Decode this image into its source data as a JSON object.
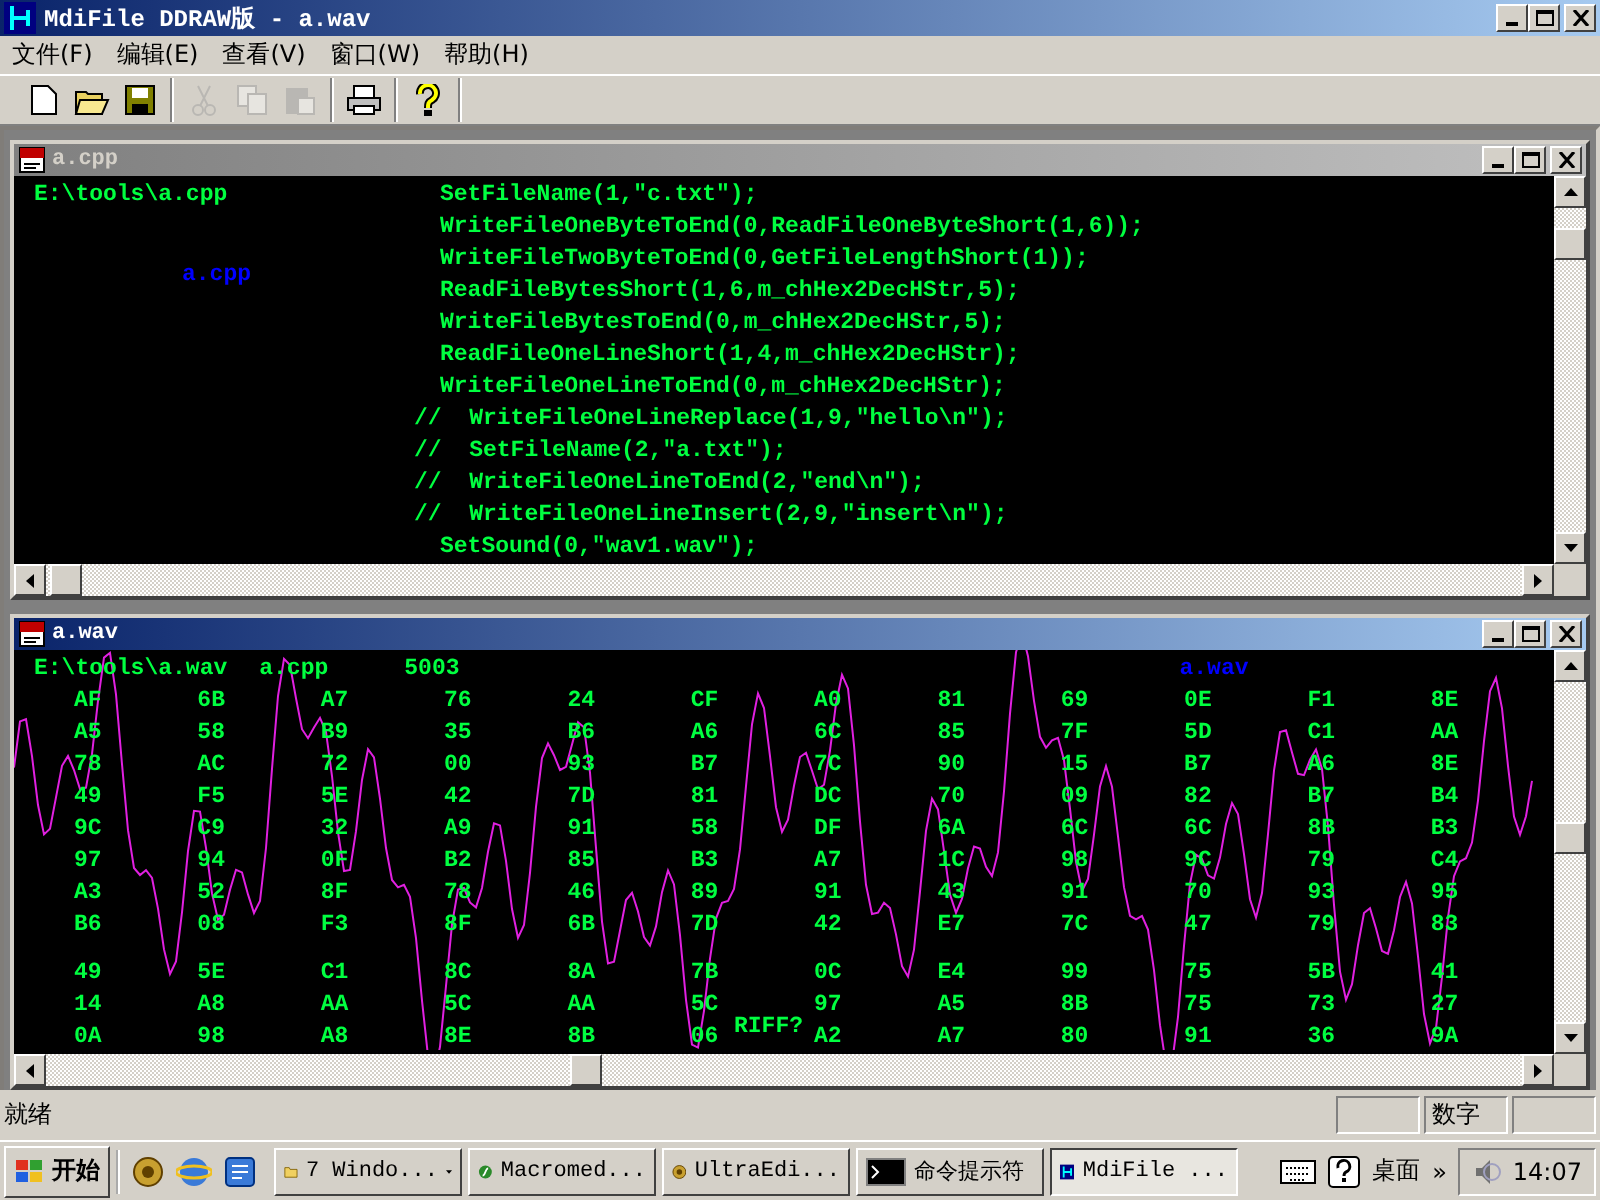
{
  "window": {
    "title": "MdiFile DDRAW版 - a.wav"
  },
  "menu": [
    {
      "label": "文件(F)"
    },
    {
      "label": "编辑(E)"
    },
    {
      "label": "查看(V)"
    },
    {
      "label": "窗口(W)"
    },
    {
      "label": "帮助(H)"
    }
  ],
  "toolbar": [
    [
      {
        "kind": "new",
        "disabled": false
      },
      {
        "kind": "open",
        "disabled": false
      },
      {
        "kind": "save",
        "disabled": false
      }
    ],
    [
      {
        "kind": "cut",
        "disabled": true
      },
      {
        "kind": "copy",
        "disabled": true
      },
      {
        "kind": "paste",
        "disabled": true
      }
    ],
    [
      {
        "kind": "print",
        "disabled": false
      }
    ],
    [
      {
        "kind": "help",
        "disabled": false
      }
    ]
  ],
  "documents": [
    {
      "title": "a.cpp",
      "active": false,
      "kind": "code",
      "path": "E:\\tools\\a.cpp",
      "label": "a.cpp",
      "lines": [
        {
          "kind": "code",
          "text": "SetFileName(1,\"c.txt\");"
        },
        {
          "kind": "code",
          "text": "WriteFileOneByteToEnd(0,ReadFileOneByteShort(1,6));"
        },
        {
          "kind": "code",
          "text": "WriteFileTwoByteToEnd(0,GetFileLengthShort(1));"
        },
        {
          "kind": "code",
          "text": "ReadFileBytesShort(1,6,m_chHex2DecHStr,5);"
        },
        {
          "kind": "code",
          "text": "WriteFileBytesToEnd(0,m_chHex2DecHStr,5);"
        },
        {
          "kind": "code",
          "text": "ReadFileOneLineShort(1,4,m_chHex2DecHStr);"
        },
        {
          "kind": "code",
          "text": "WriteFileOneLineToEnd(0,m_chHex2DecHStr);"
        },
        {
          "kind": "comment",
          "text": "//  WriteFileOneLineReplace(1,9,\"hello\\n\");"
        },
        {
          "kind": "comment",
          "text": "//  SetFileName(2,\"a.txt\");"
        },
        {
          "kind": "comment",
          "text": "//  WriteFileOneLineToEnd(2,\"end\\n\");"
        },
        {
          "kind": "comment",
          "text": "//  WriteFileOneLineInsert(2,9,\"insert\\n\");"
        },
        {
          "kind": "code",
          "text": "SetSound(0,\"wav1.wav\");"
        }
      ]
    },
    {
      "title": "a.wav",
      "active": true,
      "kind": "hex",
      "path": "E:\\tools\\a.wav",
      "source": "a.cpp",
      "size": "5003",
      "label": "a.wav",
      "overlay": "RIFF?",
      "columns": [
        [
          "AF",
          "A5",
          "78",
          "49",
          "9C",
          "97",
          "A3",
          "B6",
          "49",
          "14",
          "0A"
        ],
        [
          "6B",
          "58",
          "AC",
          "F5",
          "C9",
          "94",
          "52",
          "08",
          "5E",
          "A8",
          "98"
        ],
        [
          "A7",
          "B9",
          "72",
          "5E",
          "32",
          "0F",
          "8F",
          "F3",
          "C1",
          "AA",
          "A8"
        ],
        [
          "76",
          "35",
          "00",
          "42",
          "A9",
          "B2",
          "78",
          "8F",
          "8C",
          "5C",
          "8E"
        ],
        [
          "24",
          "B6",
          "93",
          "7D",
          "91",
          "85",
          "46",
          "6B",
          "8A",
          "AA",
          "8B"
        ],
        [
          "CF",
          "A6",
          "B7",
          "81",
          "58",
          "B3",
          "89",
          "7D",
          "7B",
          "5C",
          "06"
        ],
        [
          "A0",
          "6C",
          "7C",
          "DC",
          "DF",
          "A7",
          "91",
          "42",
          "0C",
          "97",
          "A2"
        ],
        [
          "81",
          "85",
          "90",
          "70",
          "6A",
          "1C",
          "43",
          "E7",
          "E4",
          "A5",
          "A7"
        ],
        [
          "69",
          "7F",
          "15",
          "09",
          "6C",
          "98",
          "91",
          "7C",
          "99",
          "8B",
          "80"
        ],
        [
          "0E",
          "5D",
          "B7",
          "82",
          "6C",
          "9C",
          "70",
          "47",
          "75",
          "75",
          "91"
        ],
        [
          "F1",
          "C1",
          "A6",
          "B7",
          "8B",
          "79",
          "93",
          "79",
          "5B",
          "73",
          "36"
        ],
        [
          "8E",
          "AA",
          "8E",
          "B4",
          "B3",
          "C4",
          "95",
          "83",
          "41",
          "27",
          "9A"
        ]
      ]
    }
  ],
  "status_bar": {
    "text": "就绪",
    "panels": [
      {
        "text": "数字"
      }
    ]
  },
  "taskbar": {
    "start": "开始",
    "quick_launch": [
      {
        "kind": "app"
      },
      {
        "kind": "browser"
      },
      {
        "kind": "desktop"
      }
    ],
    "tasks": [
      {
        "kind": "folder",
        "label": "7 Windo...",
        "grouped": true,
        "selected": false
      },
      {
        "kind": "flash",
        "label": "Macromed...",
        "grouped": false,
        "selected": false
      },
      {
        "kind": "app",
        "label": "UltraEdi...",
        "grouped": false,
        "selected": false
      },
      {
        "kind": "console",
        "label": "命令提示符",
        "grouped": false,
        "selected": false
      },
      {
        "kind": "mdi",
        "label": "MdiFile ...",
        "grouped": false,
        "selected": true
      }
    ],
    "toolbar_label": "桌面",
    "more": "»",
    "clock": "14:07"
  }
}
